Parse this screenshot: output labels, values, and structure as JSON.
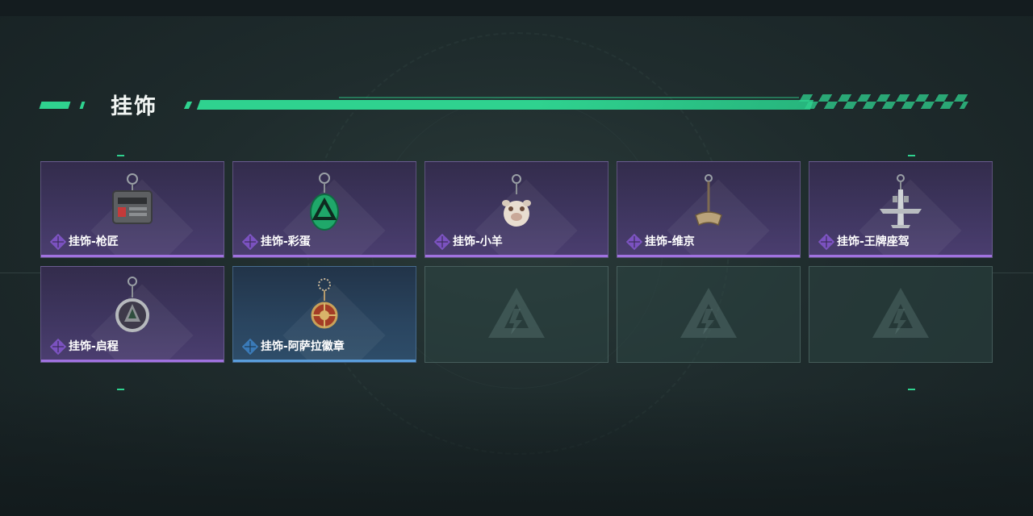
{
  "section": {
    "title": "挂饰"
  },
  "colors": {
    "accent": "#2fd28f",
    "rarity_purple": "#a072e0",
    "rarity_blue": "#5a9edc"
  },
  "items": [
    {
      "label": "挂饰-枪匠",
      "rarity": "purple",
      "icon": "gunsmith-charm-icon"
    },
    {
      "label": "挂饰-彩蛋",
      "rarity": "purple",
      "icon": "easter-egg-charm-icon"
    },
    {
      "label": "挂饰-小羊",
      "rarity": "purple",
      "icon": "lamb-charm-icon"
    },
    {
      "label": "挂饰-维京",
      "rarity": "purple",
      "icon": "viking-charm-icon"
    },
    {
      "label": "挂饰-王牌座驾",
      "rarity": "purple",
      "icon": "jet-plane-charm-icon"
    },
    {
      "label": "挂饰-启程",
      "rarity": "purple",
      "icon": "departure-charm-icon"
    },
    {
      "label": "挂饰-阿萨拉徽章",
      "rarity": "blue",
      "icon": "asala-badge-charm-icon"
    }
  ],
  "empty_slots": 3,
  "empty_slot_icon": "game-logo-icon"
}
